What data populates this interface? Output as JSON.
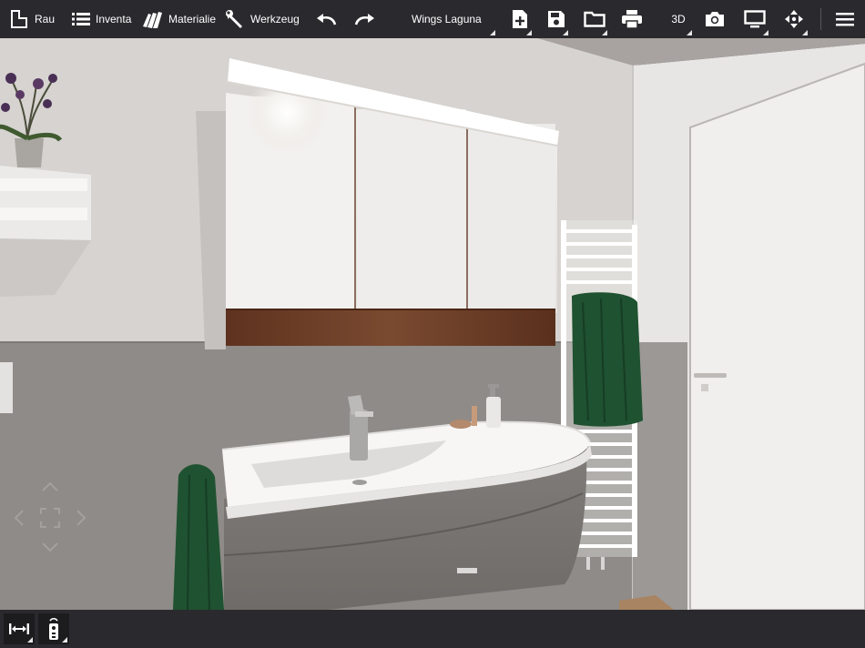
{
  "toolbar": {
    "room_label": "Rau",
    "inventory_label": "Inventa",
    "materials_label": "Materialie",
    "tools_label": "Werkzeug",
    "project_name": "Wings Laguna",
    "view_mode_label": "3D",
    "icons": {
      "room": "floorplan-icon",
      "inventory": "list-icon",
      "materials": "swatches-icon",
      "tools": "wrench-icon",
      "undo": "undo-icon",
      "redo": "redo-icon",
      "new": "new-file-icon",
      "save": "save-icon",
      "open": "folder-icon",
      "print": "print-icon",
      "camera": "camera-icon",
      "display": "monitor-icon",
      "move": "move-arrows-icon",
      "menu": "hamburger-menu-icon"
    }
  },
  "bottom": {
    "icons": {
      "measure": "measure-width-icon",
      "remote": "remote-control-icon"
    }
  },
  "nav": {
    "icons": {
      "up": "chevron-up-icon",
      "down": "chevron-down-icon",
      "left": "chevron-left-icon",
      "right": "chevron-right-icon",
      "center": "frame-icon"
    }
  },
  "colors": {
    "toolbar_bg": "#2a2a2e",
    "wall": "#d7d4d1",
    "tile": "#8f8c89",
    "towel": "#1f5230",
    "wood": "#6a3b25"
  }
}
